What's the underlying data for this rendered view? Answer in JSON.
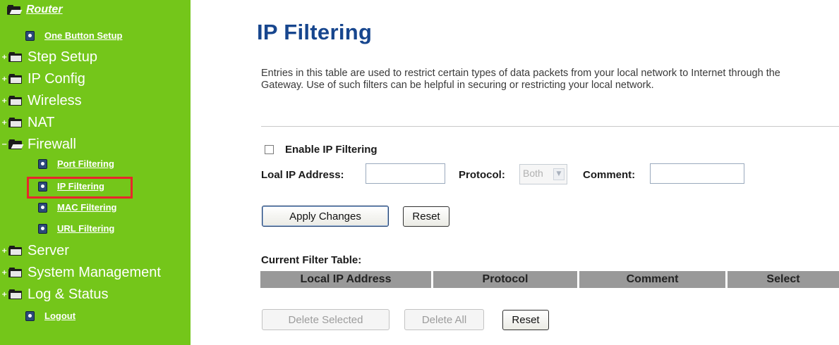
{
  "sidebar": {
    "root_label": "Router",
    "one_button_setup": "One Button Setup",
    "step_setup": "Step Setup",
    "ip_config": "IP Config",
    "wireless": "Wireless",
    "nat": "NAT",
    "firewall": "Firewall",
    "firewall_children": [
      "Port Filtering",
      "IP Filtering",
      "MAC Filtering",
      "URL Filtering"
    ],
    "server": "Server",
    "system_management": "System Management",
    "log_status": "Log & Status",
    "logout": "Logout",
    "selected_item": "IP Filtering",
    "highlight_color": "#e8262b",
    "background_color": "#74c61a"
  },
  "main": {
    "title": "IP Filtering",
    "title_color": "#17468e",
    "description": "Entries in this table are used to restrict certain types of data packets from your local network to Internet through the Gateway. Use of such filters can be helpful in securing or restricting your local network.",
    "enable_label": "Enable IP Filtering",
    "enable_checked": false,
    "local_ip_label": "Loal IP Address:",
    "local_ip_value": "",
    "protocol_label": "Protocol:",
    "protocol_value": "Both",
    "comment_label": "Comment:",
    "comment_value": "",
    "apply_button": "Apply Changes",
    "reset_button": "Reset",
    "table_title": "Current Filter Table:",
    "table_columns": [
      "Local IP Address",
      "Protocol",
      "Comment",
      "Select"
    ],
    "delete_selected_button": "Delete Selected",
    "delete_all_button": "Delete All",
    "table_reset_button": "Reset"
  }
}
